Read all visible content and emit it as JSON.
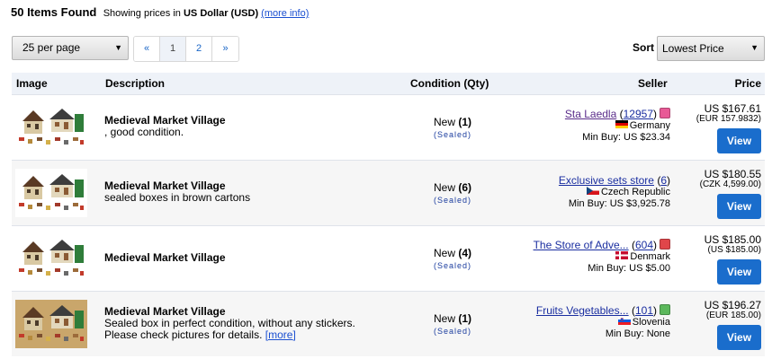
{
  "header": {
    "count": "50 Items Found",
    "showing_prefix": "Showing prices in",
    "currency": "US Dollar (USD)",
    "more_info": "(more info)"
  },
  "per_page": {
    "selected": "25 per page"
  },
  "pager": {
    "prev": "«",
    "pages": [
      "1",
      "2"
    ],
    "next": "»"
  },
  "sort": {
    "label": "Sort",
    "selected": "Lowest Price"
  },
  "columns": {
    "image": "Image",
    "description": "Description",
    "condition": "Condition (Qty)",
    "seller": "Seller",
    "price": "Price"
  },
  "rows": [
    {
      "name": "Medieval Market Village",
      "desc1": ", good condition.",
      "desc2": "",
      "more": "",
      "condition": "New",
      "qty": "(1)",
      "sealed": "(Sealed)",
      "seller": "Sta Laedla",
      "feedback_open": "(",
      "feedback": "12957",
      "feedback_close": ")",
      "cube_color": "#e85a96",
      "country": "Germany",
      "flag": "de",
      "min_buy": "Min Buy: US $23.34",
      "price": "US $167.61",
      "converted": "(EUR 157.9832)",
      "button": "View"
    },
    {
      "name": "Medieval Market Village",
      "desc1": "sealed boxes in brown cartons",
      "desc2": "",
      "more": "",
      "condition": "New",
      "qty": "(6)",
      "sealed": "(Sealed)",
      "seller": "Exclusive sets store",
      "feedback_open": "(",
      "feedback": "6",
      "feedback_close": ")",
      "cube_color": "",
      "country": "Czech Republic",
      "flag": "cz",
      "min_buy": "Min Buy: US $3,925.78",
      "price": "US $180.55",
      "converted": "(CZK 4,599.00)",
      "button": "View"
    },
    {
      "name": "Medieval Market Village",
      "desc1": "",
      "desc2": "",
      "more": "",
      "condition": "New",
      "qty": "(4)",
      "sealed": "(Sealed)",
      "seller": "The Store of Adve...",
      "feedback_open": "(",
      "feedback": "604",
      "feedback_close": ")",
      "cube_color": "#e0464a",
      "country": "Denmark",
      "flag": "dk",
      "min_buy": "Min Buy: US $5.00",
      "price": "US $185.00",
      "converted": "(US $185.00)",
      "button": "View"
    },
    {
      "name": "Medieval Market Village",
      "desc1": "Sealed box in perfect condition, without any stickers.",
      "desc2": "Please check pictures for details.",
      "more": "[more]",
      "condition": "New",
      "qty": "(1)",
      "sealed": "(Sealed)",
      "seller": "Fruits Vegetables...",
      "feedback_open": "(",
      "feedback": "101",
      "feedback_close": ")",
      "cube_color": "#5cb85c",
      "country": "Slovenia",
      "flag": "si",
      "min_buy": "Min Buy: None",
      "price": "US $196.27",
      "converted": "(EUR 185.00)",
      "button": "View"
    }
  ]
}
